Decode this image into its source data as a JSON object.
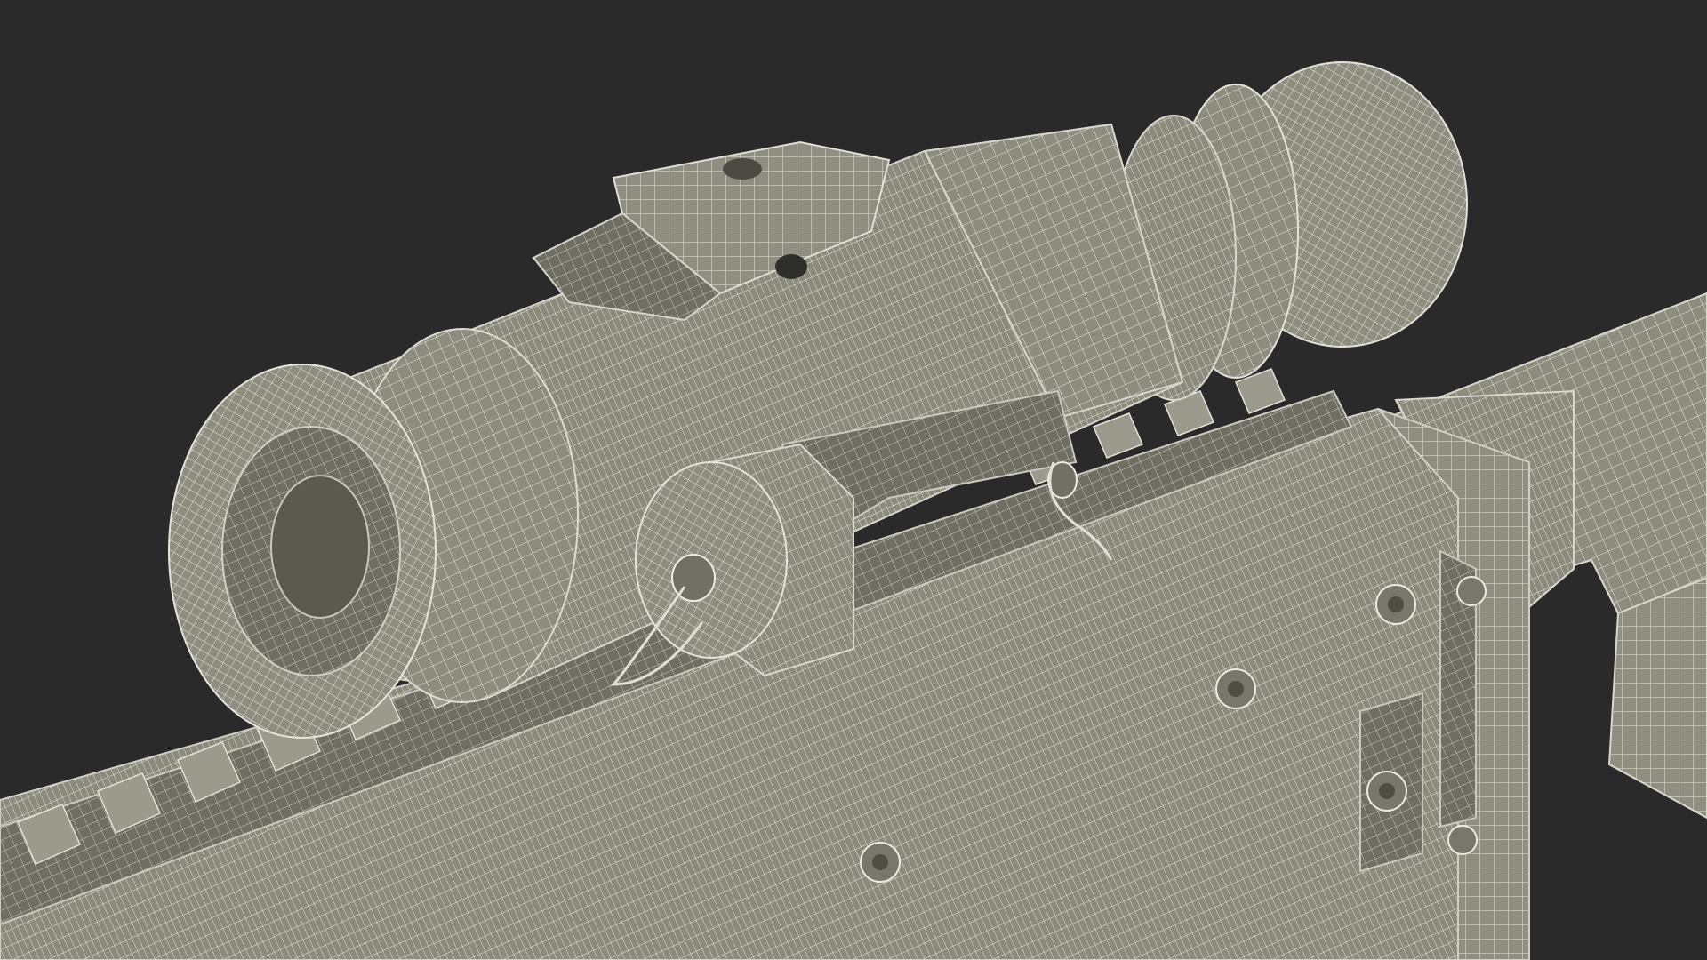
{
  "viewport": {
    "background": "#2a2a2a",
    "surface_color": "#8e8e80",
    "wire_color": "#e6e6dc",
    "shadow_color": "#5c5c52"
  },
  "model": {
    "parts": [
      "rifle-receiver",
      "picatinny-rail",
      "scope-objective",
      "scope-tube",
      "scope-turret",
      "scope-eyepiece",
      "scope-top-mount",
      "stock",
      "receiver-screws"
    ]
  }
}
